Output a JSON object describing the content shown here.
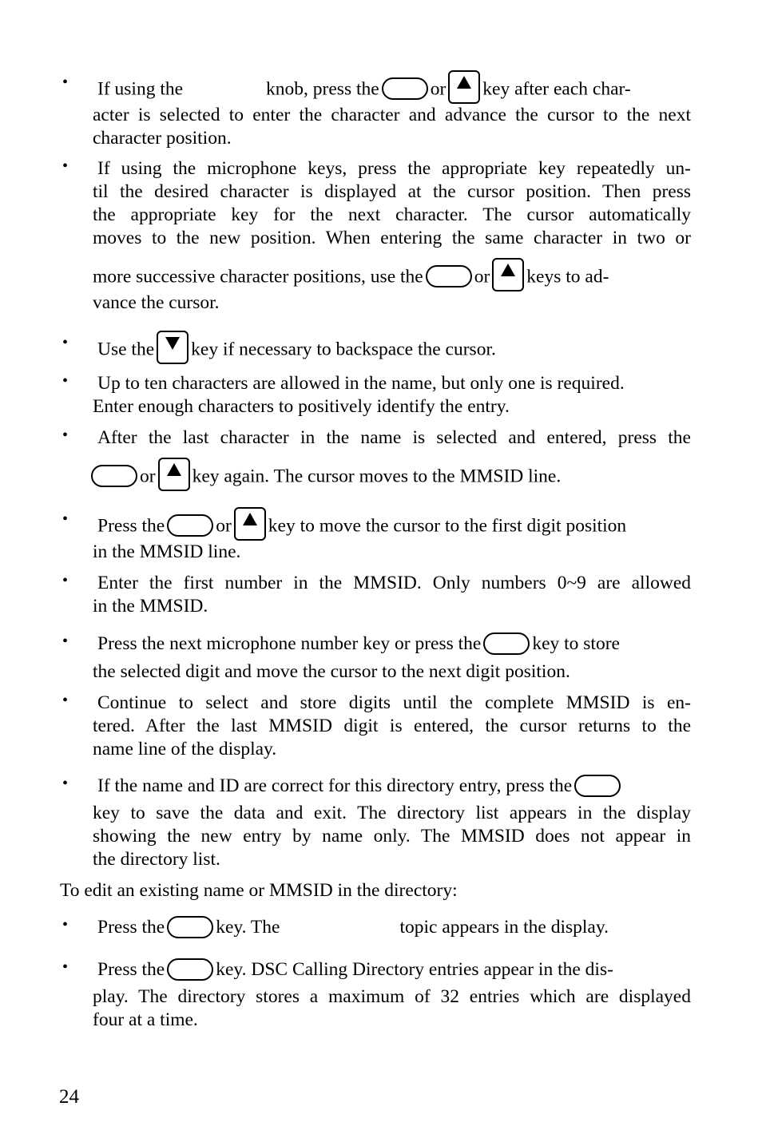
{
  "page_number": "24",
  "bullets": [
    {
      "lines": [
        [
          "If using the",
          "knob, press the",
          "or",
          "key after each char-"
        ],
        [
          "acter is selected to enter the character and advance the cursor to the next"
        ],
        [
          "character position."
        ]
      ]
    },
    {
      "lines": [
        [
          "If using the microphone keys, press the appropriate key repeatedly un-"
        ],
        [
          "til the desired character is displayed at the cursor position.  Then press"
        ],
        [
          "the appropriate key for the next character.  The cursor automatically"
        ],
        [
          "moves to the new position.  When entering the same character in two or"
        ],
        [
          "more successive character positions, use the",
          "or",
          "keys to ad-"
        ],
        [
          "vance the cursor."
        ]
      ]
    },
    {
      "lines": [
        [
          "Use the",
          "key if necessary to backspace the cursor."
        ]
      ]
    },
    {
      "lines": [
        [
          "Up to ten characters are allowed in the name, but only one is required."
        ],
        [
          "Enter enough characters to positively identify the entry."
        ]
      ]
    },
    {
      "lines": [
        [
          "After the last character in the name is selected and entered, press the"
        ],
        [
          "or",
          "key again.  The cursor moves to the MMSID line."
        ]
      ]
    },
    {
      "lines": [
        [
          "Press the",
          "or",
          "key to move the cursor to the first digit position"
        ],
        [
          "in the MMSID line."
        ]
      ]
    },
    {
      "lines": [
        [
          "Enter the first number in the MMSID.  Only numbers 0~9 are allowed"
        ],
        [
          "in the MMSID."
        ]
      ]
    },
    {
      "lines": [
        [
          "Press the next microphone number key or press the",
          "key to store"
        ],
        [
          "the selected digit and move the cursor to the next digit position."
        ]
      ]
    },
    {
      "lines": [
        [
          "Continue to select and store digits until the complete MMSID is en-"
        ],
        [
          "tered.  After the last MMSID digit is entered, the cursor returns to the"
        ],
        [
          "name line of the display."
        ]
      ]
    },
    {
      "lines": [
        [
          "If the name and ID are correct for this directory entry, press the"
        ],
        [
          "key to save the data and exit.  The directory list appears in the display"
        ],
        [
          "showing the new entry by name only.  The MMSID does not appear in"
        ],
        [
          "the directory list."
        ]
      ]
    }
  ],
  "edit_intro": "To edit an existing name or MMSID in the directory:",
  "edit_bullets": [
    {
      "lines": [
        [
          "Press the",
          "key.  The",
          "topic appears in the display."
        ]
      ]
    },
    {
      "lines": [
        [
          "Press the",
          "key.  DSC Calling Directory entries appear in the dis-"
        ],
        [
          "play.  The directory stores a maximum of 32 entries which are displayed"
        ],
        [
          "four at a time."
        ]
      ]
    }
  ],
  "bullet_glyph": "•",
  "icons": {
    "oval_key": "blank-oval-key-icon",
    "up_key": "up-arrow-key-icon",
    "down_key": "down-arrow-key-icon"
  }
}
